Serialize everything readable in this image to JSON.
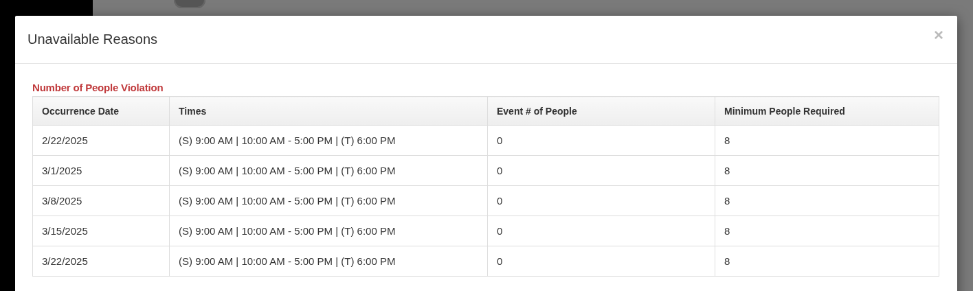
{
  "dialog": {
    "title": "Unavailable Reasons",
    "close": "×"
  },
  "section": {
    "title": "Number of People Violation"
  },
  "table": {
    "columns": [
      "Occurrence Date",
      "Times",
      "Event # of People",
      "Minimum People Required"
    ],
    "rows": [
      [
        "2/22/2025",
        "(S) 9:00 AM | 10:00 AM - 5:00 PM | (T) 6:00 PM",
        "0",
        "8"
      ],
      [
        "3/1/2025",
        "(S) 9:00 AM | 10:00 AM - 5:00 PM | (T) 6:00 PM",
        "0",
        "8"
      ],
      [
        "3/8/2025",
        "(S) 9:00 AM | 10:00 AM - 5:00 PM | (T) 6:00 PM",
        "0",
        "8"
      ],
      [
        "3/15/2025",
        "(S) 9:00 AM | 10:00 AM - 5:00 PM | (T) 6:00 PM",
        "0",
        "8"
      ],
      [
        "3/22/2025",
        "(S) 9:00 AM | 10:00 AM - 5:00 PM | (T) 6:00 PM",
        "0",
        "8"
      ]
    ]
  }
}
